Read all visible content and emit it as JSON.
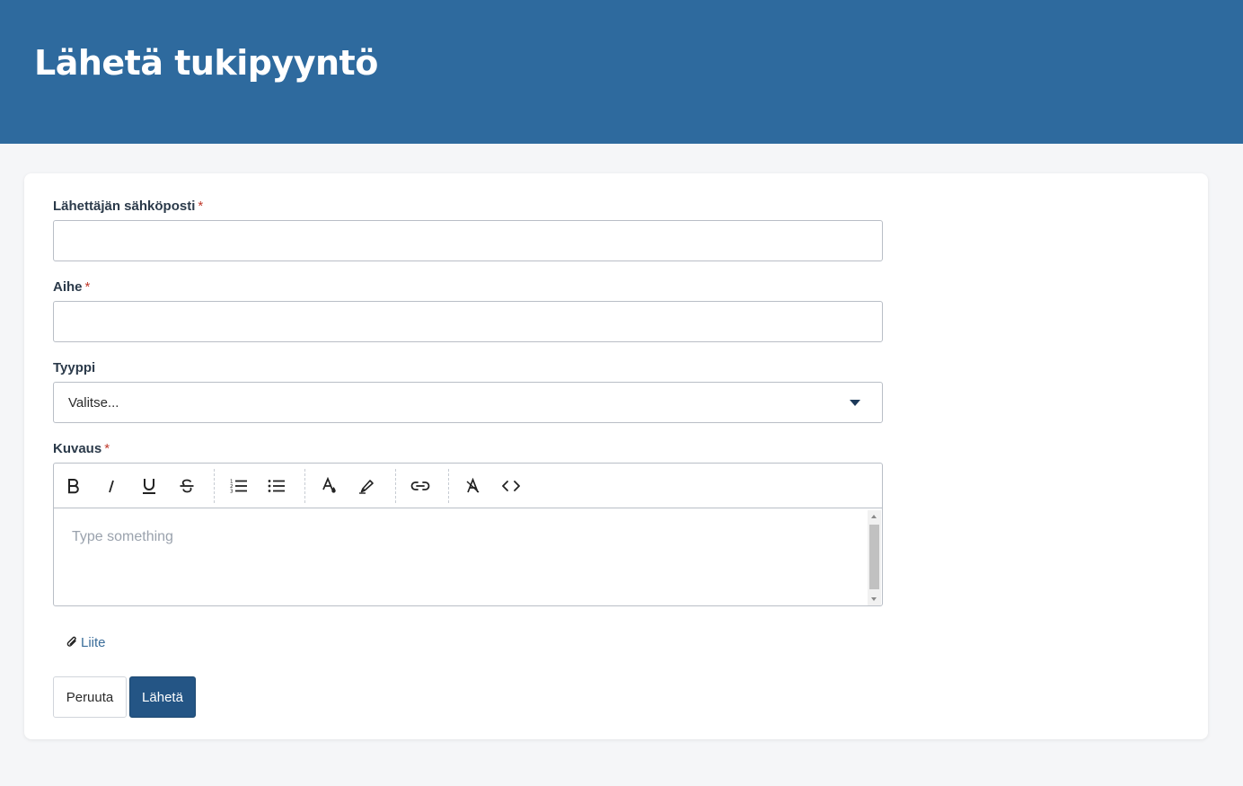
{
  "header": {
    "title": "Lähetä tukipyyntö"
  },
  "form": {
    "email": {
      "label": "Lähettäjän sähköposti",
      "required_mark": "*",
      "value": ""
    },
    "subject": {
      "label": "Aihe",
      "required_mark": "*",
      "value": ""
    },
    "type": {
      "label": "Tyyppi",
      "selected": "Valitse..."
    },
    "description": {
      "label": "Kuvaus",
      "required_mark": "*",
      "placeholder": "Type something",
      "toolbar": [
        "bold-icon",
        "italic-icon",
        "underline-icon",
        "strikethrough-icon",
        "ordered-list-icon",
        "bullet-list-icon",
        "text-color-icon",
        "highlight-icon",
        "link-icon",
        "clear-format-icon",
        "code-icon"
      ]
    },
    "attachment": {
      "label": "Liite",
      "icon": "paperclip-icon"
    },
    "buttons": {
      "cancel": "Peruuta",
      "submit": "Lähetä"
    }
  },
  "colors": {
    "header_bg": "#2e6a9e",
    "primary_button": "#245585",
    "required": "#c0392b",
    "link": "#3a6d9a"
  }
}
